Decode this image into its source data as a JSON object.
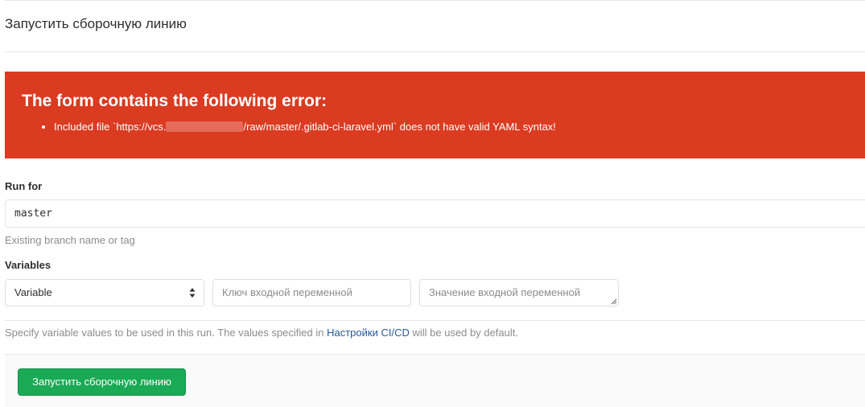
{
  "page": {
    "title": "Запустить сборочную линию"
  },
  "error": {
    "title": "The form contains the following error:",
    "message_prefix": "Included file `https://vcs.",
    "message_suffix": "/raw/master/.gitlab-ci-laravel.yml` does not have valid YAML syntax!"
  },
  "run_for": {
    "label": "Run for",
    "value": "master",
    "help": "Existing branch name or tag"
  },
  "variables": {
    "label": "Variables",
    "type_selected": "Variable",
    "key_placeholder": "Ключ входной переменной",
    "value_placeholder": "Значение входной переменной",
    "help_prefix": "Specify variable values to be used in this run. The values specified in ",
    "help_link": "Настройки CI/CD",
    "help_suffix": " will be used by default."
  },
  "actions": {
    "run_button": "Запустить сборочную линию"
  },
  "colors": {
    "error_bg": "#db3b21",
    "button_bg": "#1aaa55",
    "link": "#2b5797"
  },
  "icons": {
    "select": "sort-arrows-icon",
    "bullet": "bullet-icon"
  }
}
